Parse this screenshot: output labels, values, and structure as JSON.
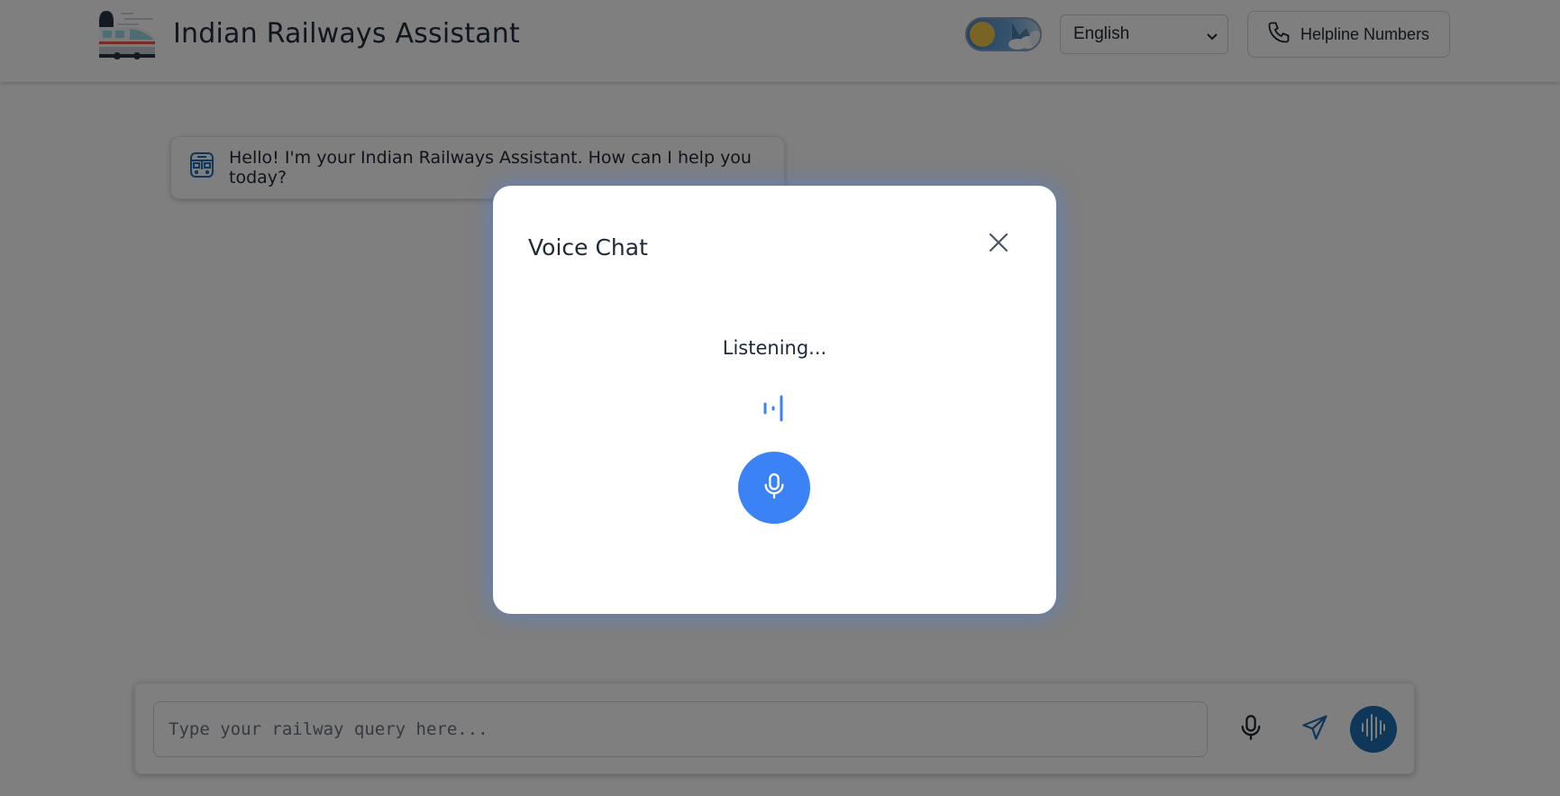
{
  "header": {
    "app_title": "Indian Railways Assistant",
    "theme_toggle_state": "light",
    "language": {
      "selected": "English"
    },
    "helpline_label": "Helpline Numbers"
  },
  "chat": {
    "messages": [
      {
        "role": "assistant",
        "text": "Hello! I'm your Indian Railways Assistant. How can I help you today?"
      }
    ]
  },
  "input": {
    "placeholder": "Type your railway query here...",
    "value": ""
  },
  "voice_modal": {
    "title": "Voice Chat",
    "status": "Listening..."
  },
  "icons": {
    "logo": "train-logo-icon",
    "helpline": "phone-icon",
    "bot": "train-front-icon",
    "mic": "microphone-icon",
    "send": "send-icon",
    "voice": "audio-wave-icon",
    "close": "close-icon"
  },
  "colors": {
    "accent": "#3b82f6",
    "voice_button": "#1f6fb5",
    "send_icon": "#1f6fb5",
    "overlay": "rgba(0,0,0,0.5)"
  }
}
